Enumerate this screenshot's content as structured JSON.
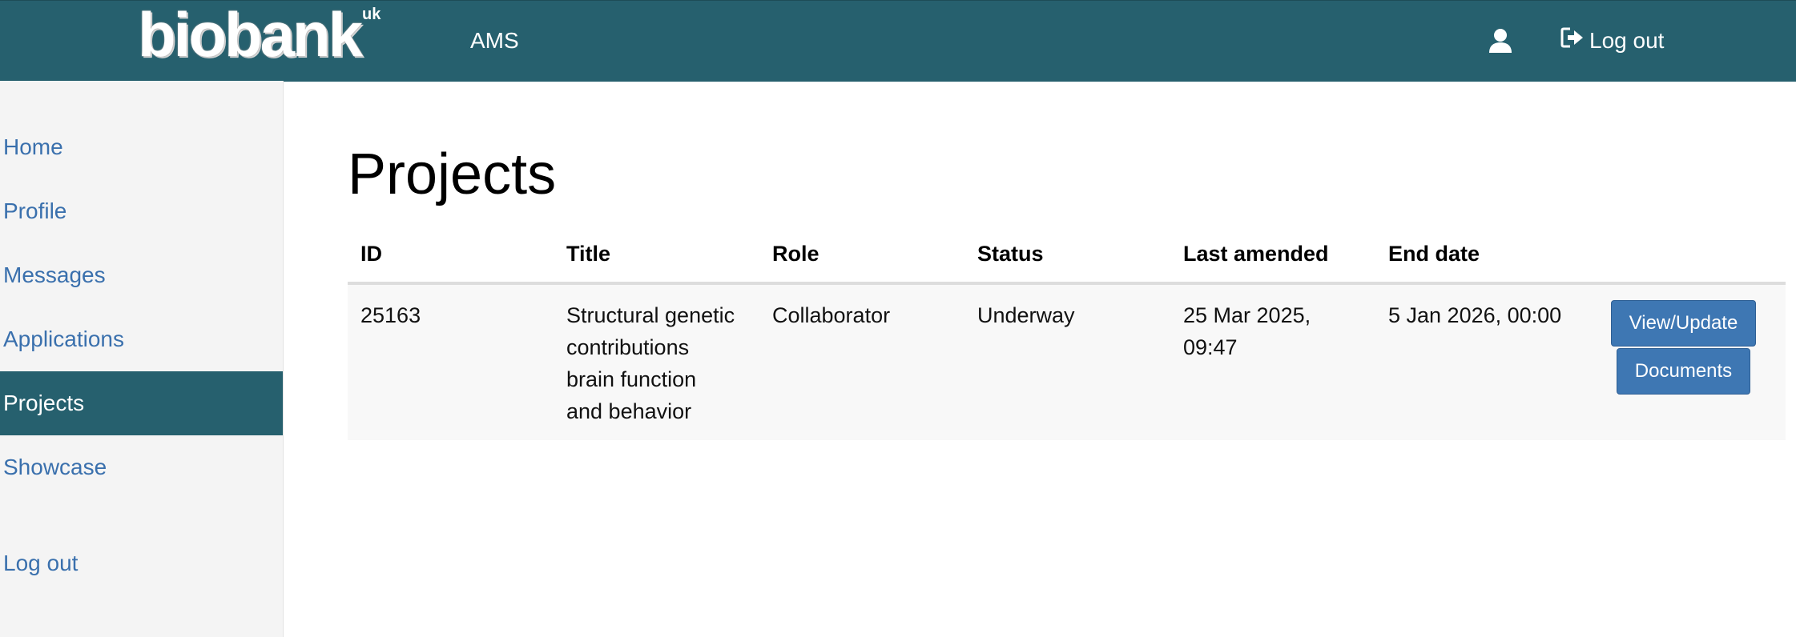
{
  "header": {
    "logo_text": "biobank",
    "logo_sup": "uk",
    "app_name": "AMS",
    "logout_label": "Log out"
  },
  "sidebar": {
    "items": [
      {
        "label": "Home"
      },
      {
        "label": "Profile"
      },
      {
        "label": "Messages"
      },
      {
        "label": "Applications"
      },
      {
        "label": "Projects",
        "active": true
      },
      {
        "label": "Showcase"
      },
      {
        "label": "Log out"
      }
    ]
  },
  "main": {
    "title": "Projects",
    "table": {
      "columns": [
        "ID",
        "Title",
        "Role",
        "Status",
        "Last amended",
        "End date"
      ],
      "rows": [
        {
          "id": "25163",
          "title_lines": [
            "Structural genetic",
            "contributions",
            "brain function",
            "and behavior"
          ],
          "role": "Collaborator",
          "status": "Underway",
          "last_amended_lines": [
            "25 Mar 2025,",
            "09:47"
          ],
          "end_date": "5 Jan 2026, 00:00",
          "view_label": "View/Update",
          "documents_label": "Documents"
        }
      ]
    }
  },
  "colors": {
    "navbar": "#26606e",
    "link": "#3a70ad",
    "button": "#3e77b3",
    "sidebar_bg": "#f4f4f4"
  }
}
